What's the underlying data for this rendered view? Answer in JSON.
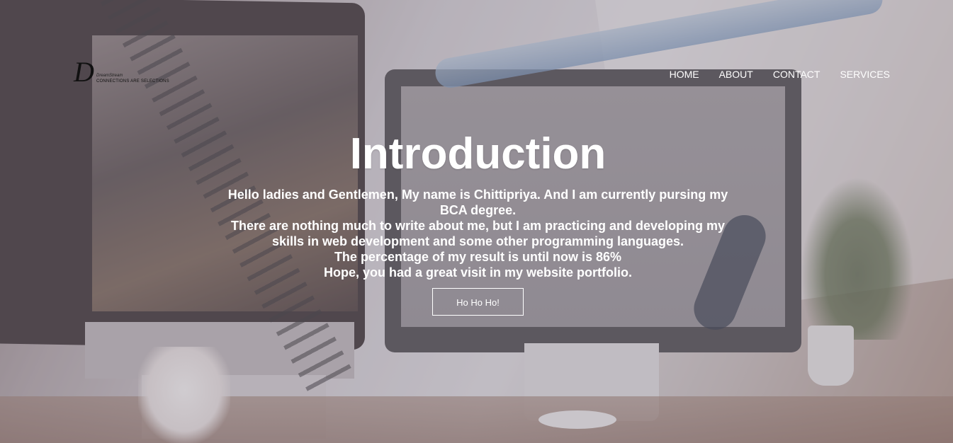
{
  "logo": {
    "mark": "D",
    "name": "DreamStream",
    "tagline": "CONNECTIONS ARE SELECTIONS"
  },
  "nav": {
    "items": [
      {
        "label": "HOME"
      },
      {
        "label": "ABOUT"
      },
      {
        "label": "CONTACT"
      },
      {
        "label": "SERVICES"
      }
    ]
  },
  "hero": {
    "title": "Introduction",
    "paragraphs": [
      "Hello ladies and Gentlemen, My name is Chittipriya. And I am currently pursing my BCA degree.",
      "There are nothing much to write about me, but I am practicing and developing my skills in web development and some other programming languages.",
      "The percentage of my result is until now is 86%",
      "Hope, you had a great visit in my website portfolio."
    ],
    "button_label": "Ho Ho Ho!"
  },
  "colors": {
    "text": "#ffffff",
    "logo": "#111111"
  },
  "icons": {
    "logo": "logo-d-icon"
  }
}
